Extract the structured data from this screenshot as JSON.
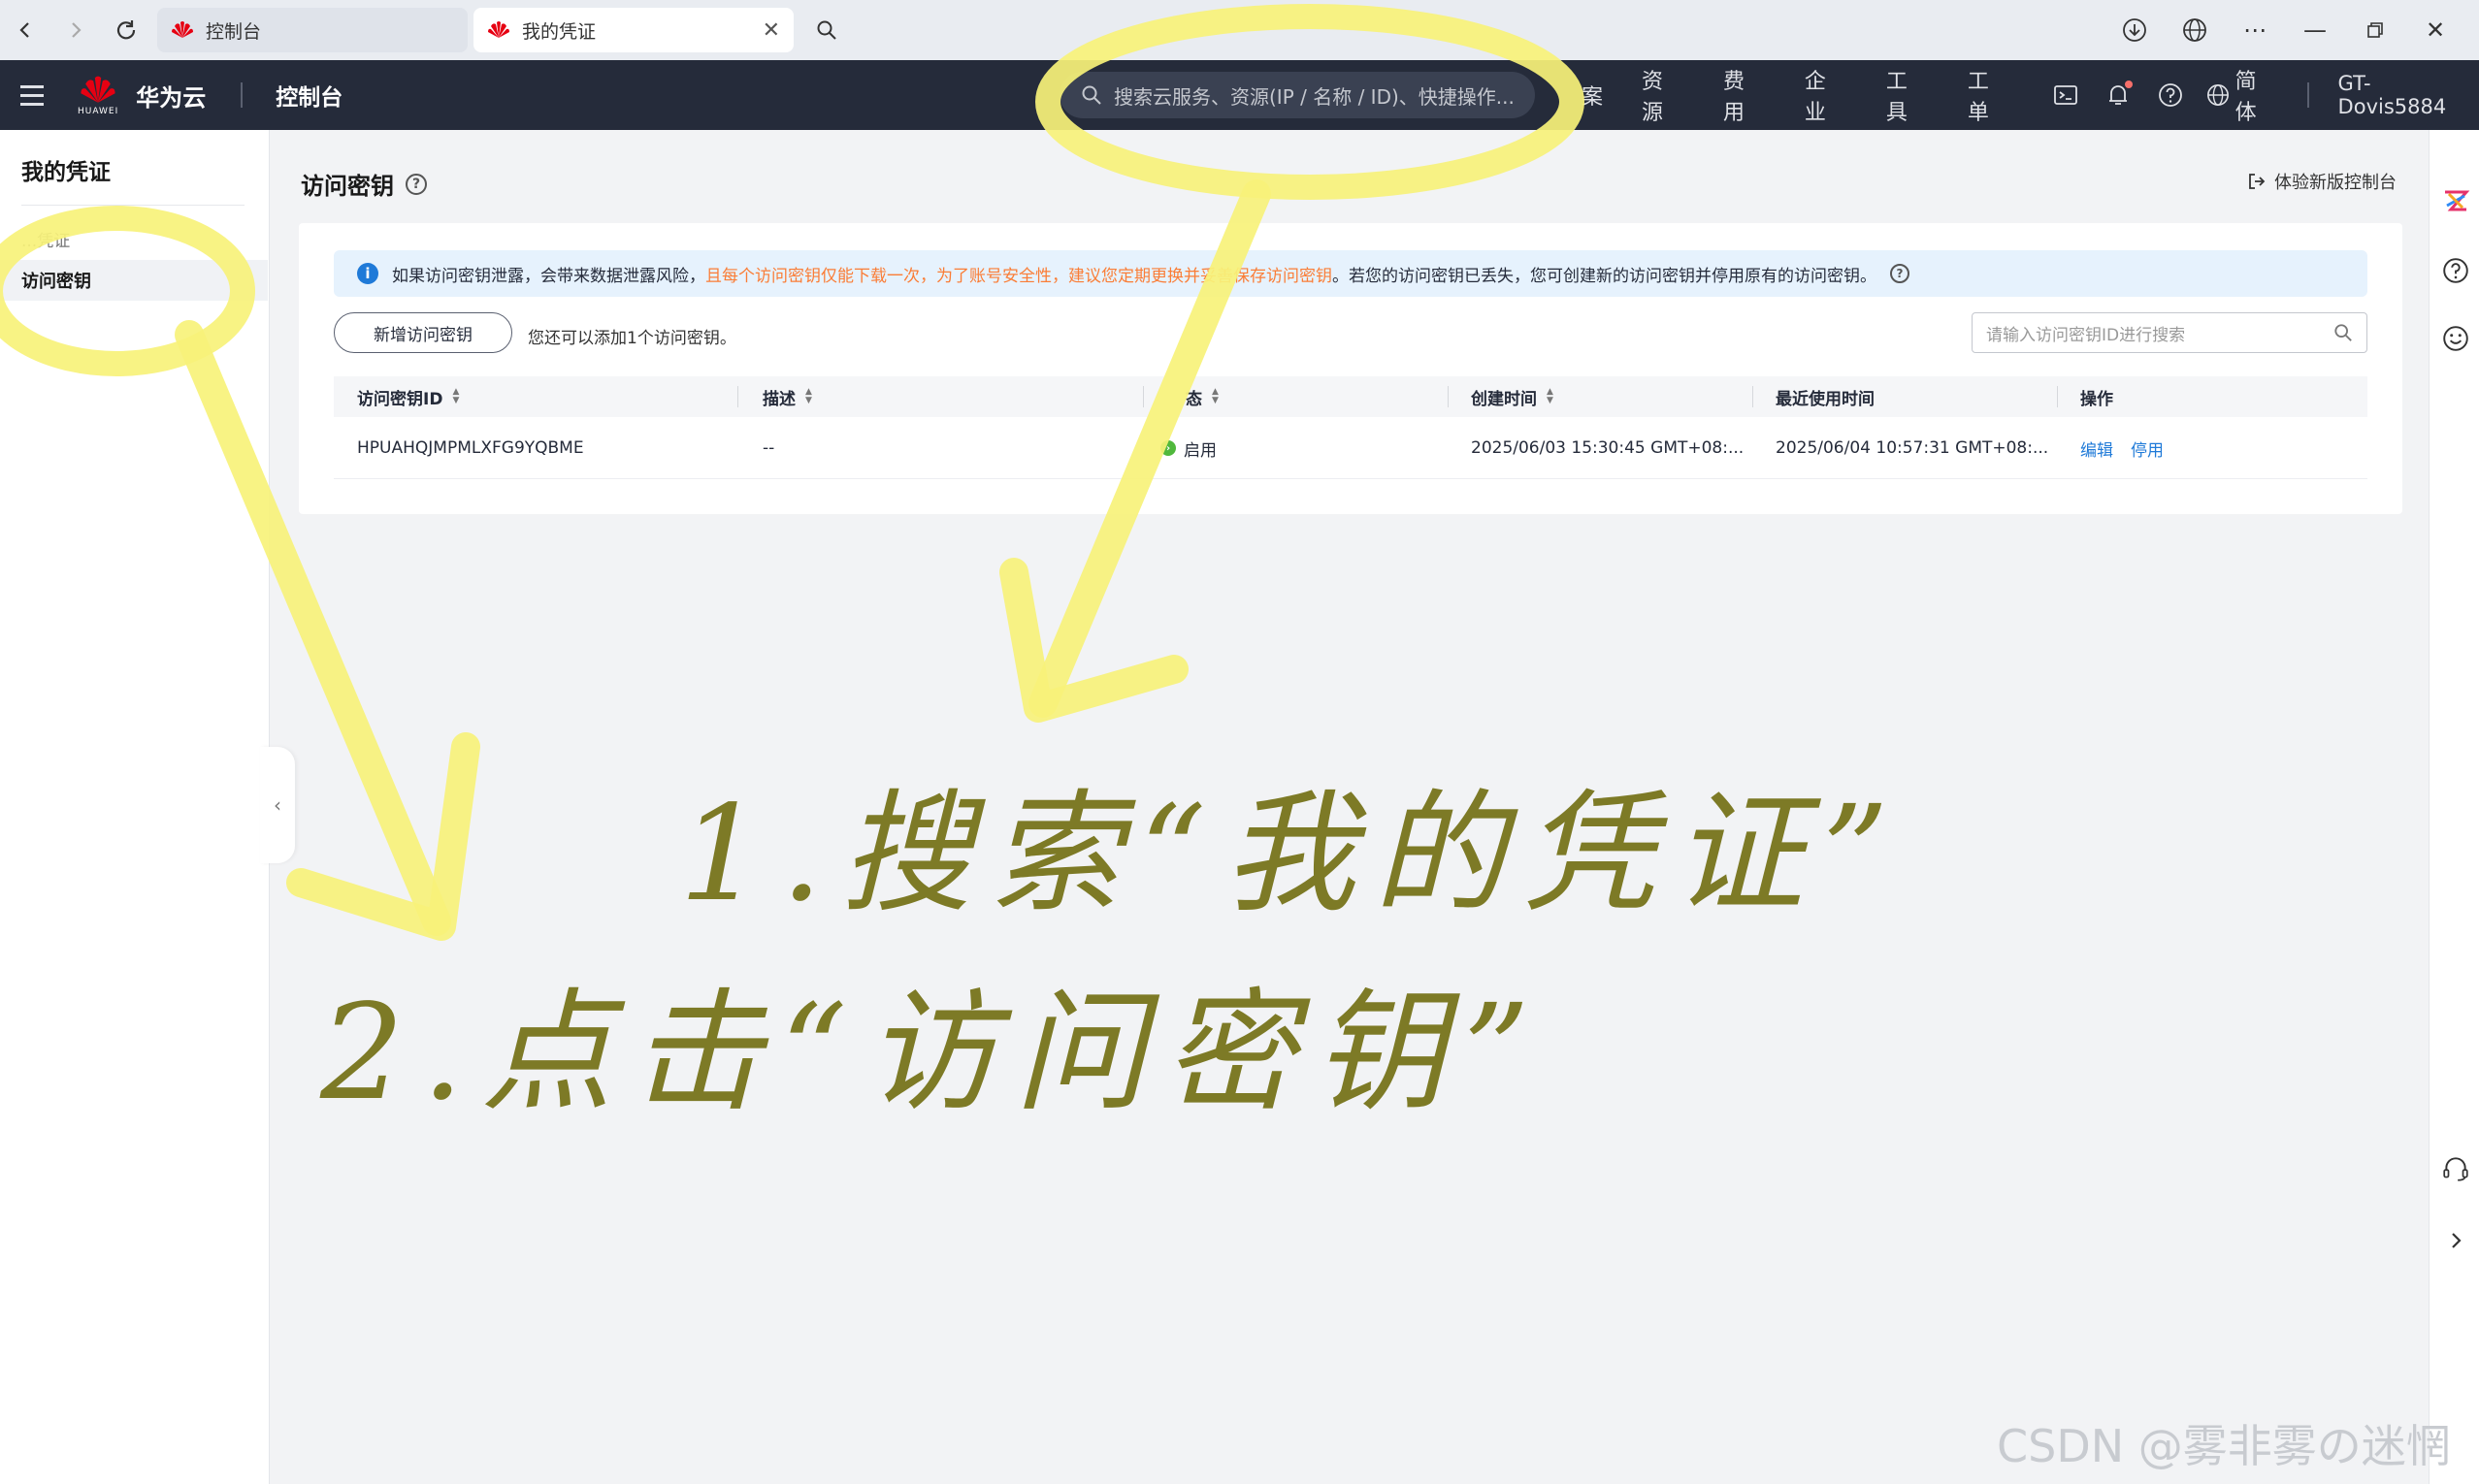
{
  "browser": {
    "tabs": [
      {
        "title": "控制台"
      },
      {
        "title": "我的凭证"
      }
    ]
  },
  "header": {
    "brand": "华为云",
    "brand_sub": "HUAWEI",
    "console": "控制台",
    "search_placeholder": "搜索云服务、资源(IP / 名称 / ID)、快捷操作...",
    "nav": [
      "案",
      "资源",
      "费用",
      "企业",
      "工具",
      "工单"
    ],
    "language": "简体",
    "username": "GT-Dovis5884"
  },
  "sidebar": {
    "title": "我的凭证",
    "hidden_item": "...凭证",
    "active_item": "访问密钥"
  },
  "main": {
    "page_title": "访问密钥",
    "new_console": "体验新版控制台",
    "alert": {
      "text_before": "如果访问密钥泄露，会带来数据泄露风险，",
      "text_warn": "且每个访问密钥仅能下载一次，为了账号安全性，建议您定期更换并妥善保存访问密钥",
      "text_after": "。若您的访问密钥已丢失，您可创建新的访问密钥并停用原有的访问密钥。"
    },
    "add_button": "新增访问密钥",
    "add_hint": "您还可以添加1个访问密钥。",
    "search_placeholder": "请输入访问密钥ID进行搜索",
    "columns": [
      "访问密钥ID",
      "描述",
      "态",
      "创建时间",
      "最近使用时间",
      "操作"
    ],
    "rows": [
      {
        "id": "HPUAHQJMPMLXFG9YQBME",
        "desc": "--",
        "status": "启用",
        "created": "2025/06/03 15:30:45 GMT+08:...",
        "last_used": "2025/06/04 10:57:31 GMT+08:...",
        "actions": [
          "编辑",
          "停用"
        ]
      }
    ]
  },
  "annotations": {
    "step1": "1.搜索“我的凭证”",
    "step2": "2.点击“访问密钥”"
  },
  "watermark": "CSDN @雾非雾の迷惘",
  "colors": {
    "header_bg": "#252b3a",
    "link": "#1f7ad8",
    "warn": "#fa7d36",
    "annotation": "#f7f27a"
  }
}
